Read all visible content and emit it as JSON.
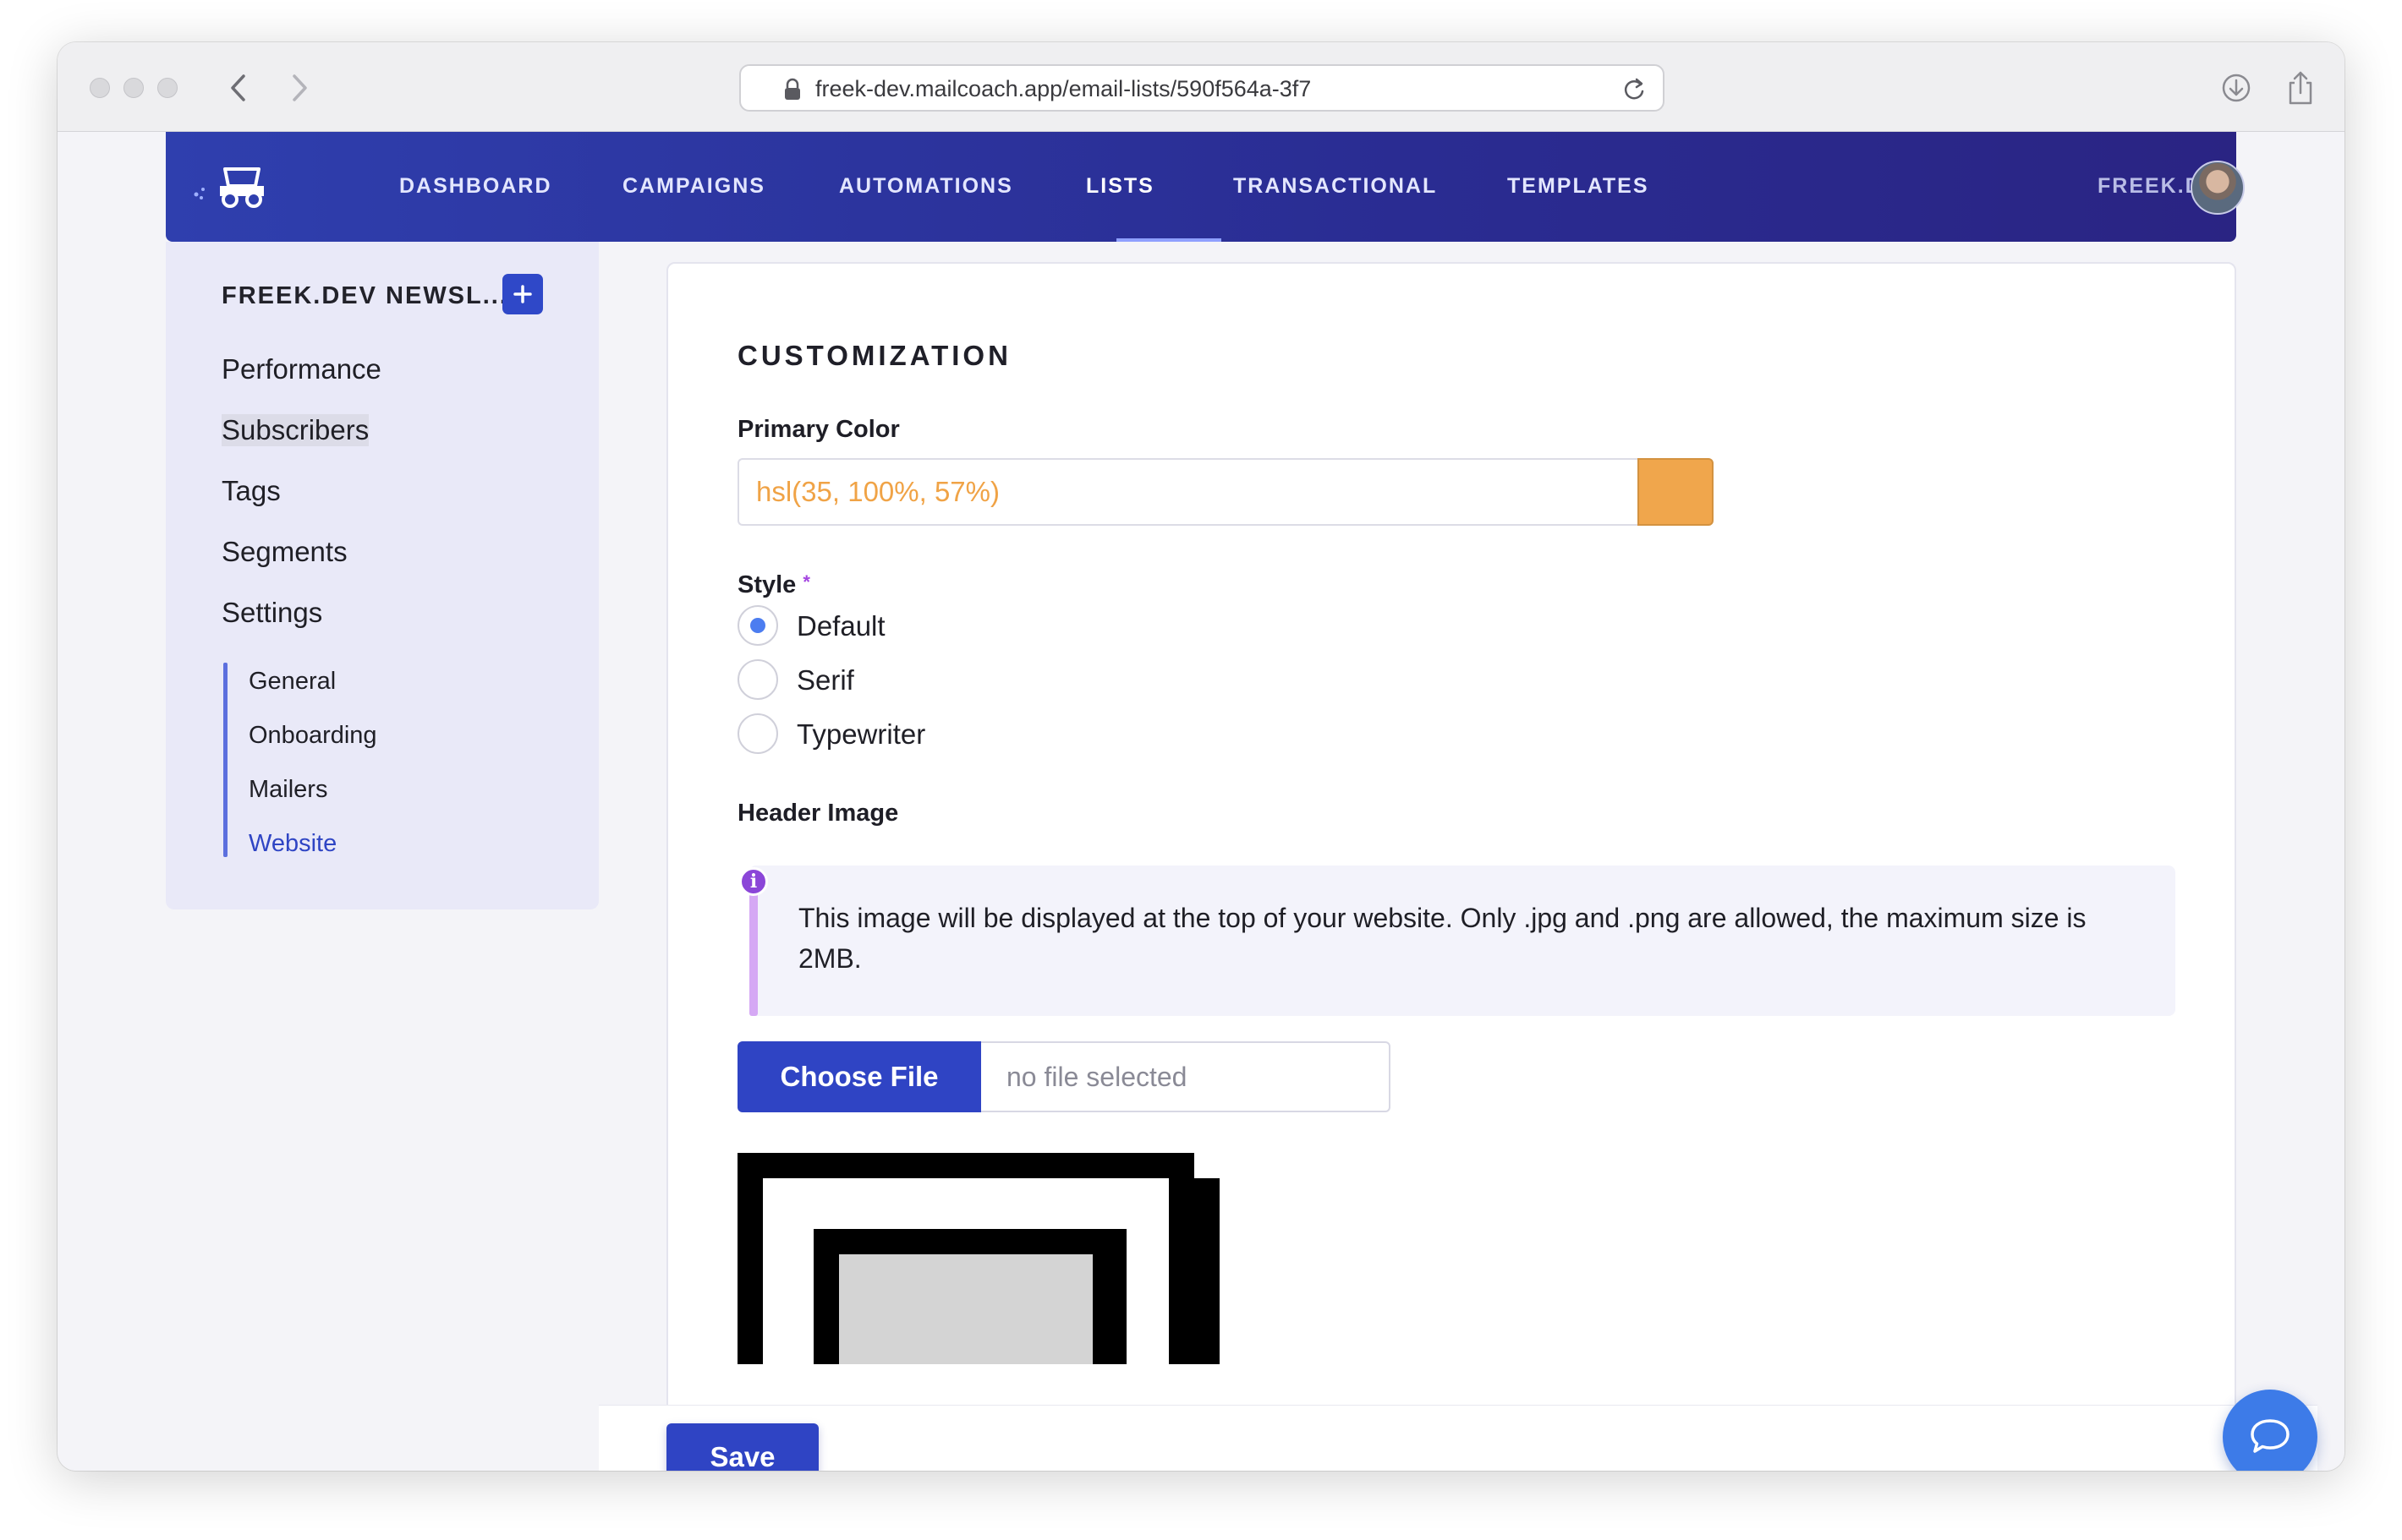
{
  "browser": {
    "url": "freek-dev.mailcoach.app/email-lists/590f564a-3f7"
  },
  "nav": {
    "items": [
      {
        "label": "DASHBOARD"
      },
      {
        "label": "CAMPAIGNS"
      },
      {
        "label": "AUTOMATIONS"
      },
      {
        "label": "LISTS"
      },
      {
        "label": "TRANSACTIONAL"
      },
      {
        "label": "TEMPLATES"
      }
    ],
    "active": "LISTS",
    "user": "FREEK.DEV"
  },
  "sidebar": {
    "list_title": "FREEK.DEV NEWSL...",
    "items": [
      {
        "label": "Performance"
      },
      {
        "label": "Subscribers"
      },
      {
        "label": "Tags"
      },
      {
        "label": "Segments"
      },
      {
        "label": "Settings"
      }
    ],
    "settings_sub": [
      {
        "label": "General"
      },
      {
        "label": "Onboarding"
      },
      {
        "label": "Mailers"
      },
      {
        "label": "Website"
      }
    ],
    "active_sub": "Website"
  },
  "form": {
    "section_title": "CUSTOMIZATION",
    "primary_color_label": "Primary Color",
    "primary_color_value": "hsl(35, 100%, 57%)",
    "swatch_color": "#f0a64c",
    "style_label": "Style",
    "required_mark": "*",
    "style_options": [
      {
        "label": "Default",
        "checked": true
      },
      {
        "label": "Serif",
        "checked": false
      },
      {
        "label": "Typewriter",
        "checked": false
      }
    ],
    "header_image_label": "Header Image",
    "header_image_help": "This image will be displayed at the top of your website. Only .jpg and .png are allowed, the maximum size is 2MB.",
    "info_icon": "i",
    "choose_file_label": "Choose File",
    "file_status": "no file selected"
  },
  "actions": {
    "save_label": "Save"
  },
  "colors": {
    "brand": "#2f44c4",
    "nav_gradient_start": "#2f3fae",
    "nav_gradient_end": "#2a2483",
    "chat": "#3d7be8"
  }
}
